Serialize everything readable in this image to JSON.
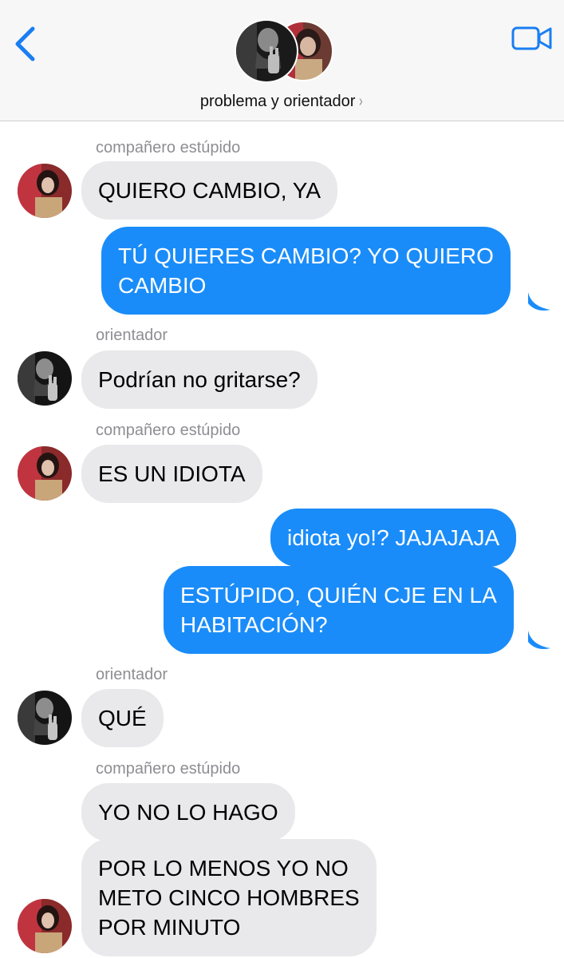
{
  "header": {
    "title": "problema y orientador",
    "chevron": "›",
    "back_icon": "chevron-left-icon",
    "video_icon": "video-camera-icon",
    "accent_color": "#1a7ef2"
  },
  "colors": {
    "incoming_bubble": "#e9e9eb",
    "outgoing_bubble": "#1a8cf9",
    "sender_label": "#8e8e93"
  },
  "messages": [
    {
      "sender": "compañero estúpido"
    },
    {
      "text": "QUIERO CAMBIO, YA",
      "direction": "incoming"
    },
    {
      "lines": [
        "TÚ QUIERES CAMBIO? YO QUIERO",
        "CAMBIO"
      ],
      "direction": "outgoing"
    },
    {
      "sender": "orientador"
    },
    {
      "text": "Podrían no gritarse?",
      "direction": "incoming"
    },
    {
      "sender": "compañero estúpido"
    },
    {
      "text": "ES UN IDIOTA",
      "direction": "incoming"
    },
    {
      "text": "idiota yo!? JAJAJAJA",
      "direction": "outgoing"
    },
    {
      "lines": [
        "ESTÚPIDO, QUIÉN CJE EN LA",
        "HABITACIÓN?"
      ],
      "direction": "outgoing"
    },
    {
      "sender": "orientador"
    },
    {
      "text": "QUÉ",
      "direction": "incoming"
    },
    {
      "sender": "compañero estúpido"
    },
    {
      "text": "YO NO LO HAGO",
      "direction": "incoming"
    },
    {
      "lines": [
        "POR LO MENOS YO NO",
        "METO CINCO HOMBRES",
        "POR MINUTO"
      ],
      "direction": "incoming"
    }
  ]
}
